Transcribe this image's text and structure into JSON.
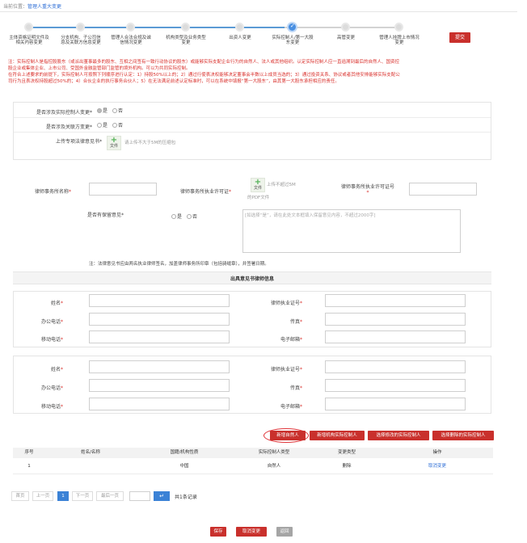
{
  "breadcrumb": {
    "prefix": "当前位置：",
    "current": "管理人重大变更"
  },
  "steps": [
    {
      "label": "主体资格证明文件及相关内容变更",
      "state": "done"
    },
    {
      "label": "分支机构、子公司信息及关联方信息变更",
      "state": "done"
    },
    {
      "label": "管理人合法合规及诚信情况变更",
      "state": "done"
    },
    {
      "label": "机构类型及业务类型变更",
      "state": "done"
    },
    {
      "label": "出资人变更",
      "state": "done"
    },
    {
      "label": "实际控制人/第一大股东变更",
      "state": "active"
    },
    {
      "label": "高管变更",
      "state": "todo"
    },
    {
      "label": "管理人挂牌上市情况变更",
      "state": "todo"
    }
  ],
  "submit_label": "提交",
  "notes": [
    "注：实际控制人是指控股股东（或派出董事最多的股东、互相之间签有一致行动协议的股东）或能够实际支配企业行为的自然人、法人或其他组织。认定实际控制人应一直追溯到最后的自然人、国资控",
    "股企业或集体企业、上市公司、受国外金融监管部门监管的境外机构。可以为共同实际控制。",
    "在符合上述要求的前提下，实际控制人可按照下列顺序进行认定：1）持股50%以上的；2）通过行使表决权能够决定董事会半数以上成员当选的；3）通过投资关系、协议或者其他安排能够实际支配公",
    "司行为且表决权持股超过50%的；4）合伙企业的执行事务合伙人；5）在无法满足前述认定标准时，可以在系统中填报“第一大股东”，由其第一大股东承担相应的责任。"
  ],
  "form1": {
    "q1_label": "是否涉及实际控制人变更*",
    "q2_label": "是否涉及关联方变更*",
    "upload_label": "上传专项法律意见书*",
    "yes": "是",
    "no": "否",
    "upload_btn": "文件",
    "upload_hint": "请上传不大于5M的压缩包"
  },
  "lawfirm": {
    "name_label": "律师事务所名称",
    "license_label": "律师事务所执业许可证",
    "license_no_label": "律师事务所执业许可证号",
    "upload_btn": "文件",
    "upload_hint1": "上传不超过5M",
    "upload_hint2": "的PDF文件",
    "reserve_label": "是否有保留意见*",
    "yes": "是",
    "no": "否",
    "textarea_placeholder": "[如选择“是”，请在此处文本框填入保留意见内容，不超过2000字]",
    "sign_note": "注：法律意见书应由两名执业律师签名，加盖律师事务所印章（包括骑缝章），并签署日期。",
    "section_title": "出具意见书律师信息"
  },
  "lawyers": [
    {
      "name": "姓名",
      "license": "律师执业证号",
      "office_phone": "办公电话",
      "fax": "传真",
      "mobile": "移动电话",
      "email": "电子邮箱"
    },
    {
      "name": "姓名",
      "license": "律师执业证号",
      "office_phone": "办公电话",
      "fax": "传真",
      "mobile": "移动电话",
      "email": "电子邮箱"
    }
  ],
  "actions": {
    "add_person": "新增自然人",
    "add_org": "新增机构实际控制人",
    "select_modify": "选择修改的实际控制人",
    "select_delete": "选择删除的实际控制人"
  },
  "table": {
    "headers": [
      "序号",
      "姓名/名称",
      "国籍/机构性质",
      "实际控制人类型",
      "变更类型",
      "操作"
    ],
    "rows": [
      {
        "seq": "1",
        "name": "",
        "nationality": "中国",
        "type": "自然人",
        "change": "删除",
        "op": "取消变更"
      }
    ]
  },
  "pager": {
    "first": "首页",
    "prev": "上一页",
    "current": "1",
    "next": "下一页",
    "last": "最后一页",
    "goto_icon": "enter-arrow-icon",
    "total": "共1条记录"
  },
  "footer": {
    "save": "保存",
    "cancel": "取消变更",
    "back": "返回"
  },
  "colors": {
    "accent": "#c9302c",
    "link": "#2f6fd6",
    "active_step": "#4a90e2"
  }
}
